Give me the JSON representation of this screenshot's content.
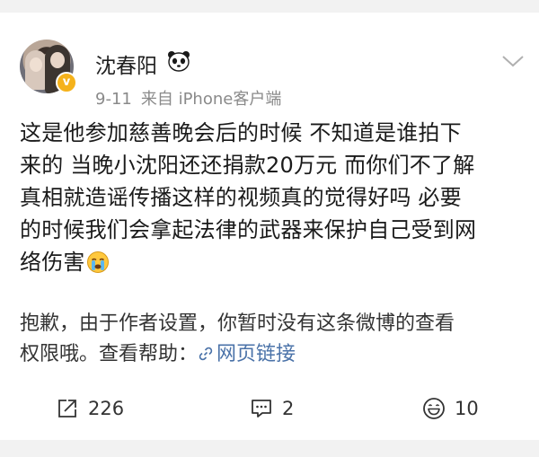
{
  "user": {
    "name": "沈春阳",
    "name_emoji": "panda-icon",
    "time": "9-11",
    "source": "来自 iPhone客户端",
    "verified_color": "#f5b21b"
  },
  "post": {
    "lines": [
      "这是他参加慈善晚会后的时候 不知道是谁拍下",
      "来的 当晚小沈阳还还捐款20万元 而你们不了解",
      "真相就造谣传播这样的视频真的觉得好吗 必要",
      "的时候我们会拿起法律的武器来保护自己受到网",
      "络伤害"
    ],
    "trailing_emoji": "crying-face-icon"
  },
  "notice": {
    "line1": "抱歉，由于作者设置，你暂时没有这条微博的查看",
    "line2_prefix": "权限哦。查看帮助：",
    "link_label": "网页链接",
    "link_color": "#4a72a8"
  },
  "actions": {
    "repost_count": "226",
    "comment_count": "2",
    "like_count": "10"
  }
}
